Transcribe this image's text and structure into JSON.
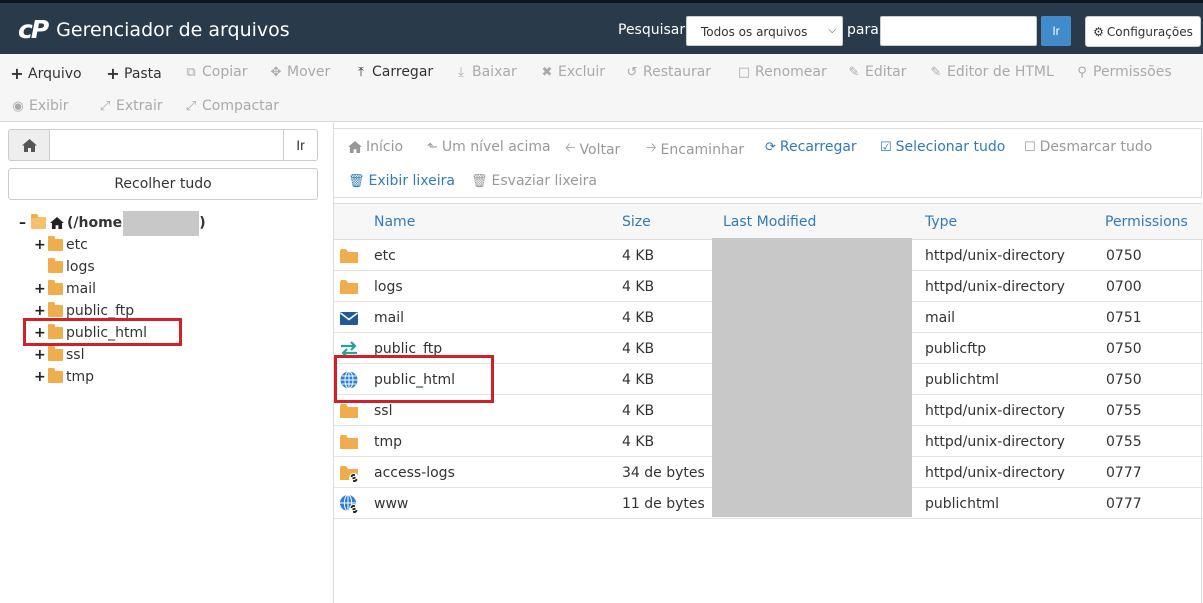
{
  "header": {
    "logo_text": "cP",
    "title": "Gerenciador de arquivos",
    "search_label": "Pesquisar",
    "search_scope": "Todos os arquivos",
    "for_label": "para",
    "search_query": "",
    "go_label": "Ir",
    "settings_label": "Configurações"
  },
  "toolbar": {
    "file": "Arquivo",
    "folder": "Pasta",
    "copy": "Copiar",
    "move": "Mover",
    "upload": "Carregar",
    "download": "Baixar",
    "delete": "Excluir",
    "restore": "Restaurar",
    "rename": "Renomear",
    "edit": "Editar",
    "html_editor": "Editor de HTML",
    "permissions": "Permissões",
    "view": "Exibir",
    "extract": "Extrair",
    "compress": "Compactar"
  },
  "tree": {
    "path_value": "",
    "go_label": "Ir",
    "collapse_label": "Recolher tudo",
    "root_label": "(/home",
    "root_close": ")",
    "items": [
      {
        "label": "etc"
      },
      {
        "label": "logs"
      },
      {
        "label": "mail"
      },
      {
        "label": "public_ftp"
      },
      {
        "label": "public_html"
      },
      {
        "label": "ssl"
      },
      {
        "label": "tmp"
      }
    ]
  },
  "nav": {
    "home": "Início",
    "up": "Um nível acima",
    "back": "Voltar",
    "forward": "Encaminhar",
    "reload": "Recarregar",
    "select_all": "Selecionar tudo",
    "deselect_all": "Desmarcar tudo",
    "view_trash": "Exibir lixeira",
    "empty_trash": "Esvaziar lixeira"
  },
  "table": {
    "columns": [
      "Name",
      "Size",
      "Last Modified",
      "Type",
      "Permissions"
    ],
    "rows": [
      {
        "icon": "folder-icon",
        "name": "etc",
        "size": "4 KB",
        "type": "httpd/unix-directory",
        "perms": "0750"
      },
      {
        "icon": "folder-icon",
        "name": "logs",
        "size": "4 KB",
        "type": "httpd/unix-directory",
        "perms": "0700"
      },
      {
        "icon": "mail-envelope-icon",
        "name": "mail",
        "size": "4 KB",
        "type": "mail",
        "perms": "0751"
      },
      {
        "icon": "transfer-arrows-icon",
        "name": "public_ftp",
        "size": "4 KB",
        "type": "publicftp",
        "perms": "0750"
      },
      {
        "icon": "globe-icon",
        "name": "public_html",
        "size": "4 KB",
        "type": "publichtml",
        "perms": "0750"
      },
      {
        "icon": "folder-icon",
        "name": "ssl",
        "size": "4 KB",
        "type": "httpd/unix-directory",
        "perms": "0755"
      },
      {
        "icon": "folder-icon",
        "name": "tmp",
        "size": "4 KB",
        "type": "httpd/unix-directory",
        "perms": "0755"
      },
      {
        "icon": "folder-link-icon",
        "name": "access-logs",
        "size": "34 de bytes",
        "type": "httpd/unix-directory",
        "perms": "0777"
      },
      {
        "icon": "globe-link-icon",
        "name": "www",
        "size": "11 de bytes",
        "type": "publichtml",
        "perms": "0777"
      }
    ]
  },
  "colors": {
    "header_bg": "#293a4a",
    "link_blue": "#337ab7",
    "folder": "#f0ad4e",
    "highlight_red": "#d0202a"
  }
}
